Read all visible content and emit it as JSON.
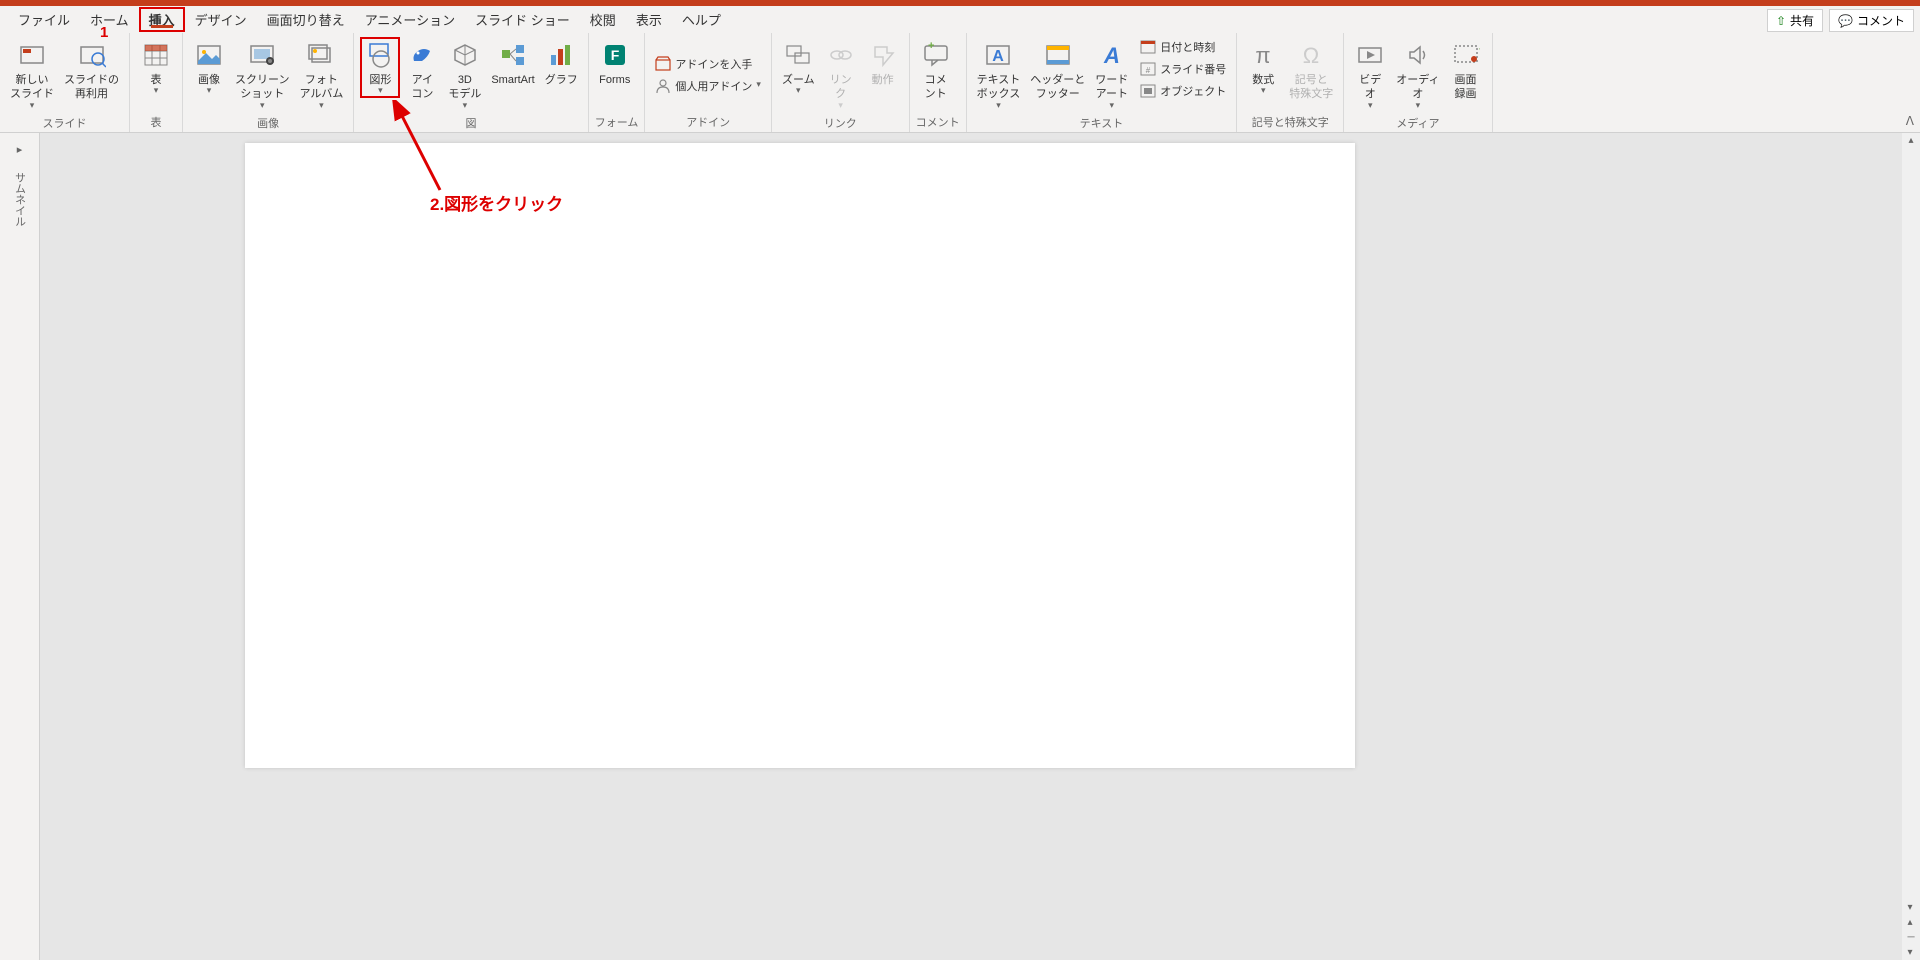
{
  "tabs": {
    "file": "ファイル",
    "home": "ホーム",
    "insert": "挿入",
    "design": "デザイン",
    "transition": "画面切り替え",
    "animation": "アニメーション",
    "slideshow": "スライド ショー",
    "review": "校閲",
    "view": "表示",
    "help": "ヘルプ"
  },
  "actions": {
    "share": "共有",
    "comment": "コメント"
  },
  "ribbon": {
    "slide_group": "スライド",
    "new_slide": "新しい\nスライド",
    "reuse": "スライドの\n再利用",
    "table_group": "表",
    "table": "表",
    "image_group": "画像",
    "picture": "画像",
    "screenshot": "スクリーン\nショット",
    "photoalbum": "フォト\nアルバム",
    "illust_group": "図",
    "shapes": "図形",
    "icons": "アイ\nコン",
    "model3d": "3D\nモデル",
    "smartart": "SmartArt",
    "chart": "グラフ",
    "form_group": "フォーム",
    "forms": "Forms",
    "addin_group": "アドイン",
    "getaddin": "アドインを入手",
    "myaddin": "個人用アドイン",
    "link_group": "リンク",
    "zoom": "ズーム",
    "link": "リン\nク",
    "action": "動作",
    "comment_group": "コメント",
    "comment_btn": "コメ\nント",
    "text_group": "テキスト",
    "textbox": "テキスト\nボックス",
    "headerfooter": "ヘッダーと\nフッター",
    "wordart": "ワード\nアート",
    "datetime": "日付と時刻",
    "slidenum": "スライド番号",
    "object": "オブジェクト",
    "symbol_group": "記号と特殊文字",
    "equation": "数式",
    "symbol": "記号と\n特殊文字",
    "media_group": "メディア",
    "video": "ビデ\nオ",
    "audio": "オーディ\nオ",
    "record": "画面\n録画"
  },
  "thumb": {
    "label": "サムネイル"
  },
  "annot": {
    "n1": "1",
    "n2": "2.図形をクリック"
  }
}
